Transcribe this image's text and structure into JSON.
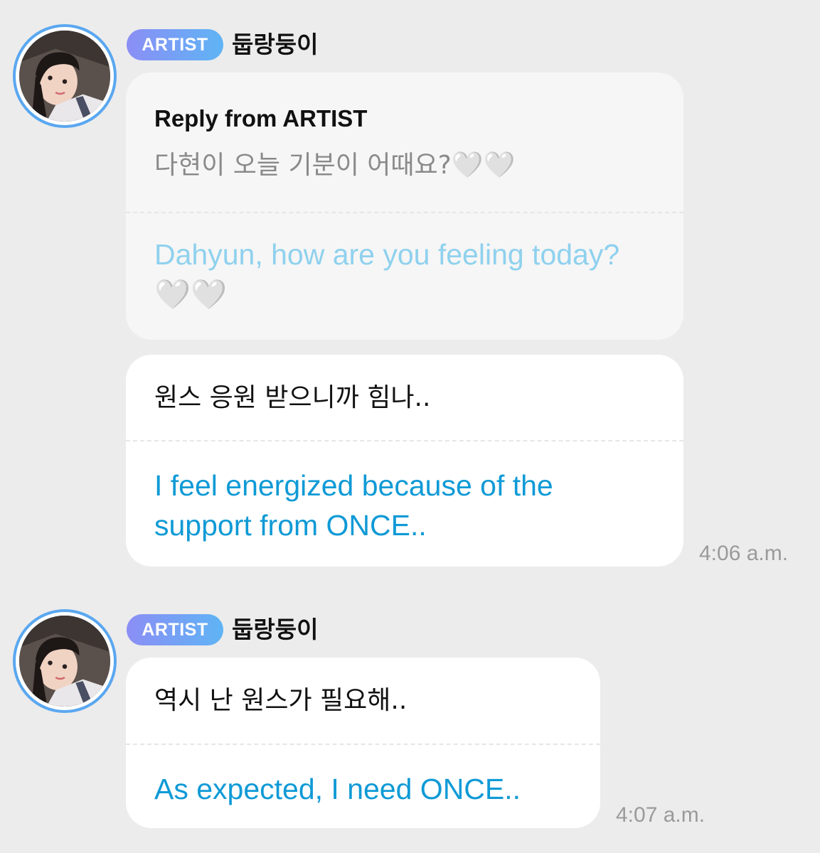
{
  "messages": [
    {
      "badge": "ARTIST",
      "username": "둡랑둥이",
      "reply": {
        "title": "Reply from ARTIST",
        "original_ko": "다현이 오늘 기분이 어때요?🤍🤍",
        "original_en": "Dahyun, how are you feeling today? 🤍🤍"
      },
      "text_ko": "원스 응원 받으니까 힘나..",
      "text_en": "I feel energized because of the support from ONCE..",
      "time": "4:06 a.m."
    },
    {
      "badge": "ARTIST",
      "username": "둡랑둥이",
      "text_ko": "역시 난 원스가 필요해..",
      "text_en": "As expected, I need ONCE..",
      "time": "4:07 a.m."
    }
  ],
  "icons": {
    "avatar": "profile-photo",
    "heart": "white-heart-emoji"
  },
  "colors": {
    "background": "#ececec",
    "bubble": "#ffffff",
    "reply_bubble": "#f6f6f6",
    "translation": "#0f9ad6",
    "muted_translation": "#8fd1ee",
    "badge_start": "#8b8ef5",
    "badge_end": "#5fb4f5",
    "avatar_ring": "#5aa7f0"
  }
}
